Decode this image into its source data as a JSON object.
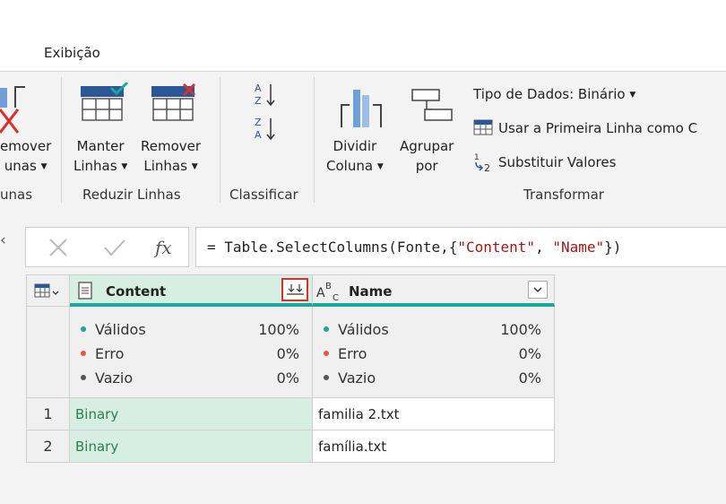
{
  "tabs": {
    "active": "Exibição"
  },
  "ribbon": {
    "remove_columns": {
      "line1": "emover",
      "line2": "unas",
      "group": "unas"
    },
    "reduce_rows": {
      "keep": {
        "line1": "Manter",
        "line2": "Linhas"
      },
      "remove": {
        "line1": "Remover",
        "line2": "Linhas"
      },
      "group": "Reduzir Linhas"
    },
    "sort": {
      "group": "Classificar"
    },
    "transform": {
      "split": {
        "line1": "Dividir",
        "line2": "Coluna"
      },
      "group_by": {
        "line1": "Agrupar",
        "line2": "por"
      },
      "data_type": "Tipo de Dados: Binário",
      "first_row_header": "Usar a Primeira Linha como C",
      "replace_values": "Substituir Valores",
      "group": "Transformar"
    }
  },
  "formula": {
    "prefix": "= Table.SelectColumns(Fonte,{",
    "str1": "\"Content\"",
    "sep": ", ",
    "str2": "\"Name\"",
    "suffix": "})"
  },
  "table": {
    "columns": [
      {
        "name": "Content",
        "type_icon": "binary-icon",
        "valid": "100%",
        "error": "0%",
        "empty": "0%"
      },
      {
        "name": "Name",
        "type_icon": "text-type-icon",
        "valid": "100%",
        "error": "0%",
        "empty": "0%"
      }
    ],
    "profile_labels": {
      "valid": "Válidos",
      "error": "Erro",
      "empty": "Vazio"
    },
    "rows": [
      {
        "num": "1",
        "content": "Binary",
        "name": "familia 2.txt"
      },
      {
        "num": "2",
        "content": "Binary",
        "name": "família.txt"
      }
    ]
  },
  "colors": {
    "valid": "#1aa89a",
    "error": "#e8534a",
    "empty": "#555555",
    "selected": "#d7efe2",
    "highlight": "#d9302c"
  }
}
